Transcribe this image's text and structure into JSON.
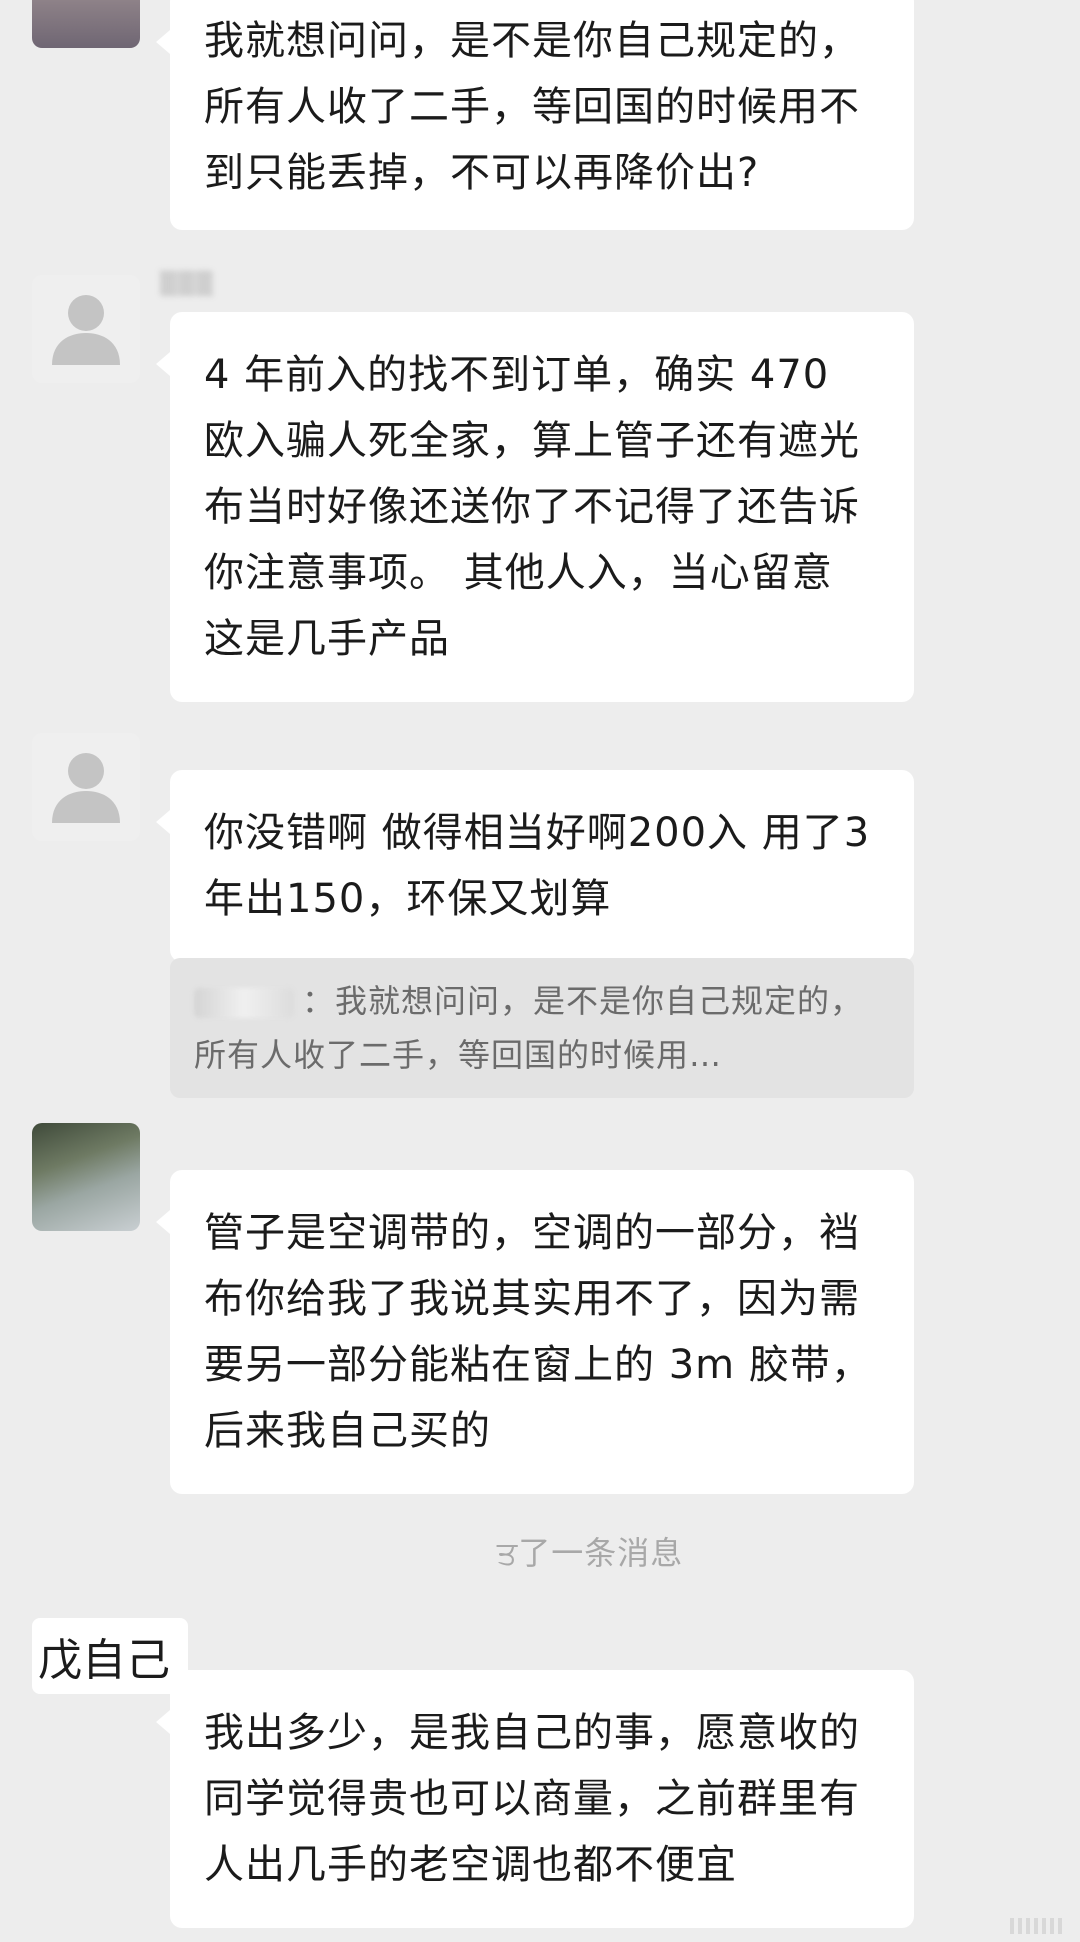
{
  "messages": [
    {
      "text": "我就想问问，是不是你自己规定的，所有人收了二手，等回国的时候用不到只能丢掉，不可以再降价出?"
    },
    {
      "text": "4 年前入的找不到订单，确实 470 欧入骗人死全家，算上管子还有遮光布当时好像还送你了不记得了还告诉你注意事项。 其他人入，当心留意 这是几手产品"
    },
    {
      "text": "你没错啊 做得相当好啊200入 用了3年出150，环保又划算",
      "quote": "：我就想问问，是不是你自己规定的，所有人收了二手，等回国的时候用…"
    },
    {
      "text": "管子是空调带的，空调的一部分，裆布你给我了我说其实用不了，因为需要另一部分能粘在窗上的 3m 胶带，后来我自己买的"
    },
    {
      "system": "ਤ了一条消息"
    },
    {
      "sender": "戊自己",
      "text": "我出多少，是我自己的事，愿意收的同学觉得贵也可以商量，之前群里有人出几手的老空调也都不便宜"
    }
  ],
  "icons": {
    "default_avatar": "person-silhouette-icon"
  },
  "colors": {
    "background": "#ededed",
    "bubble": "#ffffff",
    "quote": "#e3e3e3",
    "text": "#1b1b1b",
    "system_text": "#a8a8a8"
  }
}
